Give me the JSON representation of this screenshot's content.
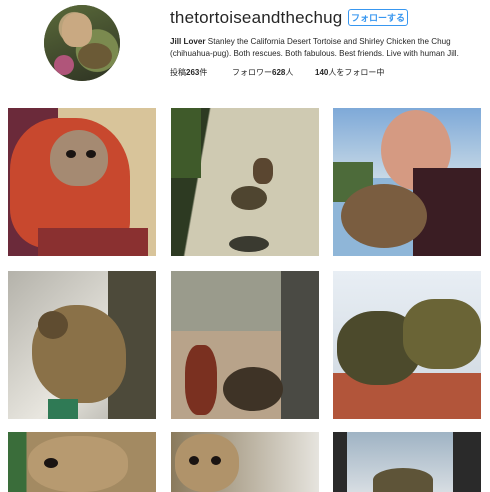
{
  "profile": {
    "username": "thetortoiseandthechug",
    "follow_label": "フォローする",
    "bio_name": "Jill Lover",
    "bio_text": " Stanley the California Desert Tortoise and Shirley Chicken the Chug (chihuahua-pug). Both rescues. Both fabulous. Best friends. Live with human Jill.",
    "stats": {
      "posts_label": "投稿",
      "posts_count": "263",
      "posts_unit": "件",
      "followers_label": "フォロワー",
      "followers_count": "628",
      "followers_unit": "人",
      "following_count": "140",
      "following_label": "人をフォロー中"
    }
  },
  "posts": [
    {
      "description": "chihuahua in red blanket"
    },
    {
      "description": "dog and tortoise on sidewalk"
    },
    {
      "description": "man kissing tortoise"
    },
    {
      "description": "tortoise held in bag"
    },
    {
      "description": "dog and tortoise at door"
    },
    {
      "description": "tortoise close-up"
    },
    {
      "description": "dog face close-up"
    },
    {
      "description": "dog face"
    },
    {
      "description": "tortoise in carrier"
    }
  ],
  "colors": {
    "accent": "#3897f0",
    "text": "#262626"
  }
}
